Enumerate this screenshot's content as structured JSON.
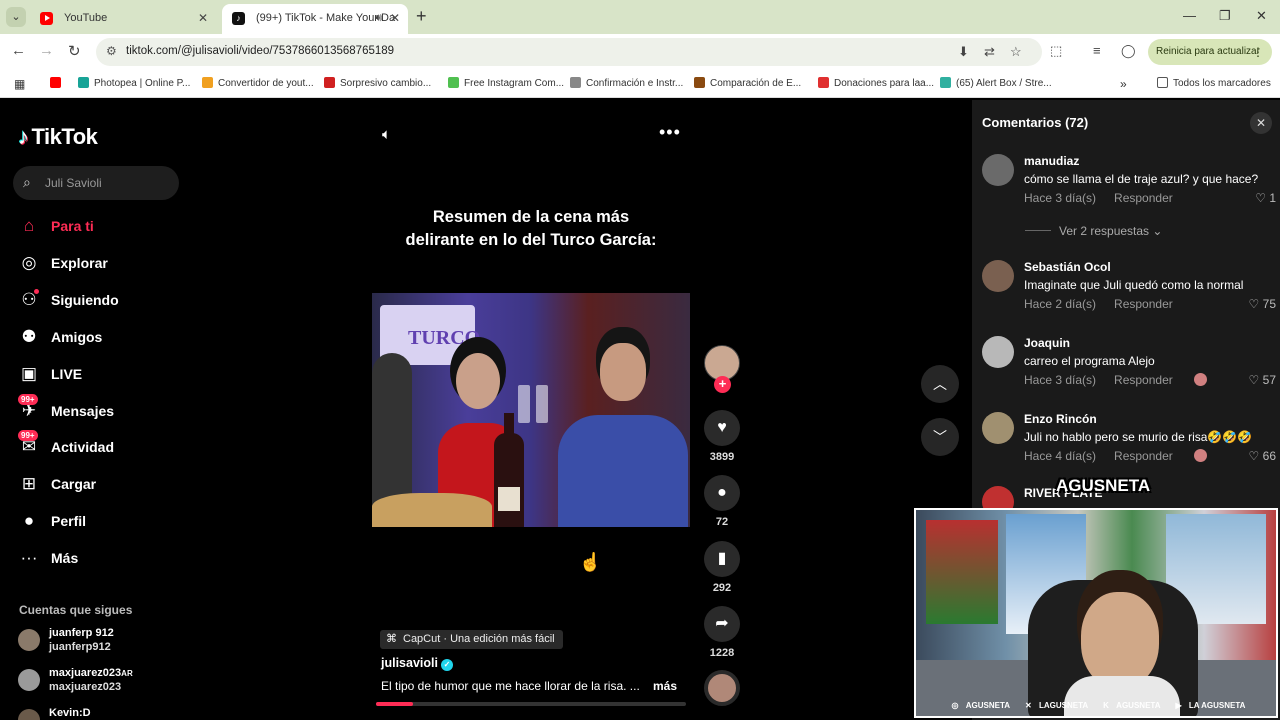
{
  "browser": {
    "tabs": [
      {
        "title": "YouTube",
        "favicon": "youtube-icon",
        "active": false
      },
      {
        "title": "(99+) TikTok - Make Your Da",
        "favicon": "tiktok-icon",
        "active": true
      }
    ],
    "url": "tiktok.com/@julisavioli/video/7537866013568765189",
    "update_button": "Reinicia para actualizar",
    "bookmarks": [
      {
        "label": "Photopea | Online P...",
        "color": "#18a497"
      },
      {
        "label": "Convertidor de yout...",
        "color": "#f0a020"
      },
      {
        "label": "Sorpresivo cambio...",
        "color": "#d02020"
      },
      {
        "label": "Free Instagram Com...",
        "color": "#50c050"
      },
      {
        "label": "Confirmación e Instr...",
        "color": "#888888"
      },
      {
        "label": "Comparación de E...",
        "color": "#8a4a10"
      },
      {
        "label": "Donaciones para laa...",
        "color": "#e03030"
      },
      {
        "label": "(65) Alert Box / Stre...",
        "color": "#30b0a0"
      }
    ],
    "all_bookmarks": "Todos los marcadores"
  },
  "sidebar": {
    "logo": "TikTok",
    "search_placeholder": "Juli Savioli",
    "nav": [
      {
        "label": "Para ti",
        "icon": "home-icon",
        "active": true
      },
      {
        "label": "Explorar",
        "icon": "compass-icon"
      },
      {
        "label": "Siguiendo",
        "icon": "following-icon"
      },
      {
        "label": "Amigos",
        "icon": "friends-icon"
      },
      {
        "label": "LIVE",
        "icon": "live-icon"
      },
      {
        "label": "Mensajes",
        "icon": "messages-icon",
        "badge": "99+"
      },
      {
        "label": "Actividad",
        "icon": "activity-icon",
        "badge": "99+"
      },
      {
        "label": "Cargar",
        "icon": "upload-icon"
      },
      {
        "label": "Perfil",
        "icon": "profile-icon"
      },
      {
        "label": "Más",
        "icon": "more-icon"
      }
    ],
    "following_header": "Cuentas que sigues",
    "following": [
      {
        "name": "juanferp 912",
        "handle": "juanferp912"
      },
      {
        "name": "maxjuarez023",
        "suffix": "AR",
        "handle": "maxjuarez023"
      },
      {
        "name": "Kevin:D",
        "handle": ""
      }
    ]
  },
  "video": {
    "caption_line1": "Resumen de la cena más",
    "caption_line2": "delirante en lo del Turco García:",
    "sign_text": "TURCO",
    "likes": "3899",
    "comments": "72",
    "saves": "292",
    "shares": "1228",
    "capcut": "CapCut · Una edición más fácil",
    "author": "julisavioli",
    "description": "El tipo de humor que me hace llorar de la risa. ...",
    "more": "más",
    "progress": 0.12
  },
  "comments": {
    "title": "Comentarios (72)",
    "items": [
      {
        "user": "manudiaz",
        "text": "cómo se llama el de traje azul? y que hace?",
        "time": "Hace 3 día(s)",
        "reply": "Responder",
        "likes": "1",
        "avatar": "#6a6a6a",
        "creator_liked": false
      },
      {
        "user": "Sebastián Ocol",
        "text": "Imaginate que Juli quedó como la normal",
        "time": "Hace 2 día(s)",
        "reply": "Responder",
        "likes": "75",
        "avatar": "#7a6050",
        "creator_liked": false
      },
      {
        "user": "Joaquin",
        "text": "carreo el programa Alejo",
        "time": "Hace 3 día(s)",
        "reply": "Responder",
        "likes": "57",
        "avatar": "#b8b8b8",
        "creator_liked": true
      },
      {
        "user": "Enzo Rincón",
        "text": "Juli no hablo pero se murio de risa🤣🤣🤣",
        "time": "Hace 4 día(s)",
        "reply": "Responder",
        "likes": "66",
        "avatar": "#a09070",
        "creator_liked": true
      },
      {
        "user": "RIVER PLATE",
        "text": "",
        "time": "",
        "reply": "",
        "likes": "",
        "avatar": "#c03030",
        "creator_liked": false
      }
    ],
    "view_replies": "Ver 2 respuestas"
  },
  "webcam": {
    "brand": "AGUSNETA",
    "socials": [
      "AGUSNETA",
      "LAGUSNETA",
      "AGUSNETA",
      "LA AGUSNETA"
    ]
  },
  "colors": {
    "accent": "#fe2c55",
    "verified": "#20d5ec"
  }
}
